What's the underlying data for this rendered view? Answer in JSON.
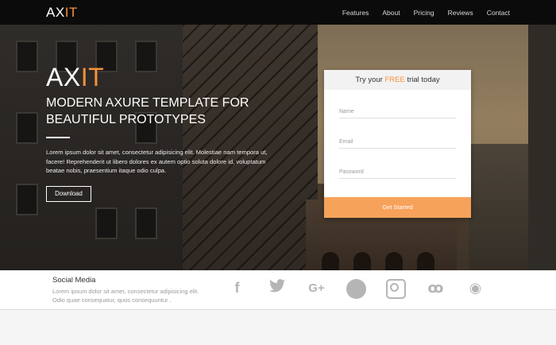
{
  "nav": {
    "logo_a": "AX",
    "logo_b": "IT",
    "links": [
      "Features",
      "About",
      "Pricing",
      "Reviews",
      "Contact"
    ]
  },
  "hero": {
    "logo_a": "AX",
    "logo_b": "IT",
    "title": "MODERN AXURE TEMPLATE FOR BEAUTIFUL PROTOTYPES",
    "description": "Lorem ipsum dolor sit amet, consectetur adipisicing elit. Molestiae nam tempora ut, facere! Reprehenderit ut libero dolores ex autem optio soluta dolore id, voluptatum beatae nobis, praesentium itaque odio culpa.",
    "button": "Download"
  },
  "form": {
    "head_a": "Try your ",
    "head_free": "FREE",
    "head_b": " trial today",
    "name_placeholder": "Name",
    "email_placeholder": "Email",
    "password_placeholder": "Password",
    "submit": "Get Started"
  },
  "social": {
    "title": "Social Media",
    "description": "Lorem ipsum dolor sit amet, consectetur adipisicing elit. Odio quae consequatur, quos consequuntur .",
    "icons": [
      "facebook-icon",
      "twitter-icon",
      "google-plus-icon",
      "pinterest-icon",
      "instagram-icon",
      "stumbleupon-icon",
      "rss-icon"
    ],
    "glyphs": {
      "facebook": "f",
      "google": "G+",
      "pinterest": "P",
      "stumbleupon": "ꚙ",
      "rss": "◉"
    }
  },
  "colors": {
    "accent": "#f7923a",
    "button": "#f7a25a",
    "nav_bg": "#0b0b0b"
  }
}
